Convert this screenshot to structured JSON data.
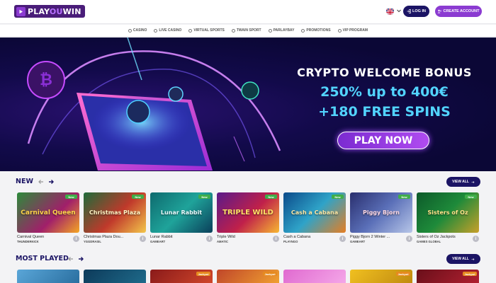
{
  "header": {
    "logo": {
      "part1": "PLAY",
      "part2": "OU",
      "part3": "WIN"
    },
    "language_flag": "uk-flag-icon",
    "login_label": "LOG IN",
    "create_account_label": "CREATE ACCOUNT",
    "colors": {
      "primary": "#1b1464",
      "accent": "#8b3bd1"
    }
  },
  "nav": {
    "items": [
      {
        "label": "CASINO",
        "icon": "casino-icon"
      },
      {
        "label": "LIVE CASINO",
        "icon": "live-casino-icon"
      },
      {
        "label": "VIRTUAL SPORTS",
        "icon": "virtual-sports-icon"
      },
      {
        "label": "TWAIN SPORT",
        "icon": "twain-sport-icon"
      },
      {
        "label": "PARLAYBAY",
        "icon": "parlaybay-icon"
      },
      {
        "label": "PROMOTIONS",
        "icon": "promotions-icon"
      },
      {
        "label": "VIP PROGRAM",
        "icon": "vip-icon"
      }
    ]
  },
  "hero": {
    "title": "CRYPTO WELCOME BONUS",
    "line1": "250% up to 400€",
    "line2": "+180 FREE SPINS",
    "cta": "PLAY NOW"
  },
  "new_section": {
    "title": "NEW",
    "view_all": "VIEW ALL",
    "games": [
      {
        "name": "Carnival Queen",
        "provider": "THUNDERKICK",
        "badge": "New",
        "art": "Carnival Queen"
      },
      {
        "name": "Christmas Plaza Dou...",
        "provider": "YGGDRASIL",
        "badge": "New",
        "art": "Christmas Plaza"
      },
      {
        "name": "Lunar Rabbit",
        "provider": "GAMEART",
        "badge": "New",
        "art": "Lunar Rabbit"
      },
      {
        "name": "Triple Wild",
        "provider": "AMATIC",
        "badge": "New",
        "art": "TRIPLE WILD"
      },
      {
        "name": "Cash a Cabana",
        "provider": "PLAYNGO",
        "badge": "New",
        "art": "Cash a Cabana"
      },
      {
        "name": "Piggy Bjorn 2 Winter ...",
        "provider": "GAMEART",
        "badge": "New",
        "art": "Piggy Bjorn"
      },
      {
        "name": "Sisters of Oz Jackpots",
        "provider": "GAMES GLOBAL",
        "badge": "New",
        "art": "Sisters of Oz"
      }
    ]
  },
  "most_played_section": {
    "title": "MOST PLAYED",
    "view_all": "VIEW ALL",
    "badges": [
      "",
      "",
      "Jackpot",
      "Jackpot",
      "",
      "Jackpot",
      "Jackpot"
    ]
  }
}
